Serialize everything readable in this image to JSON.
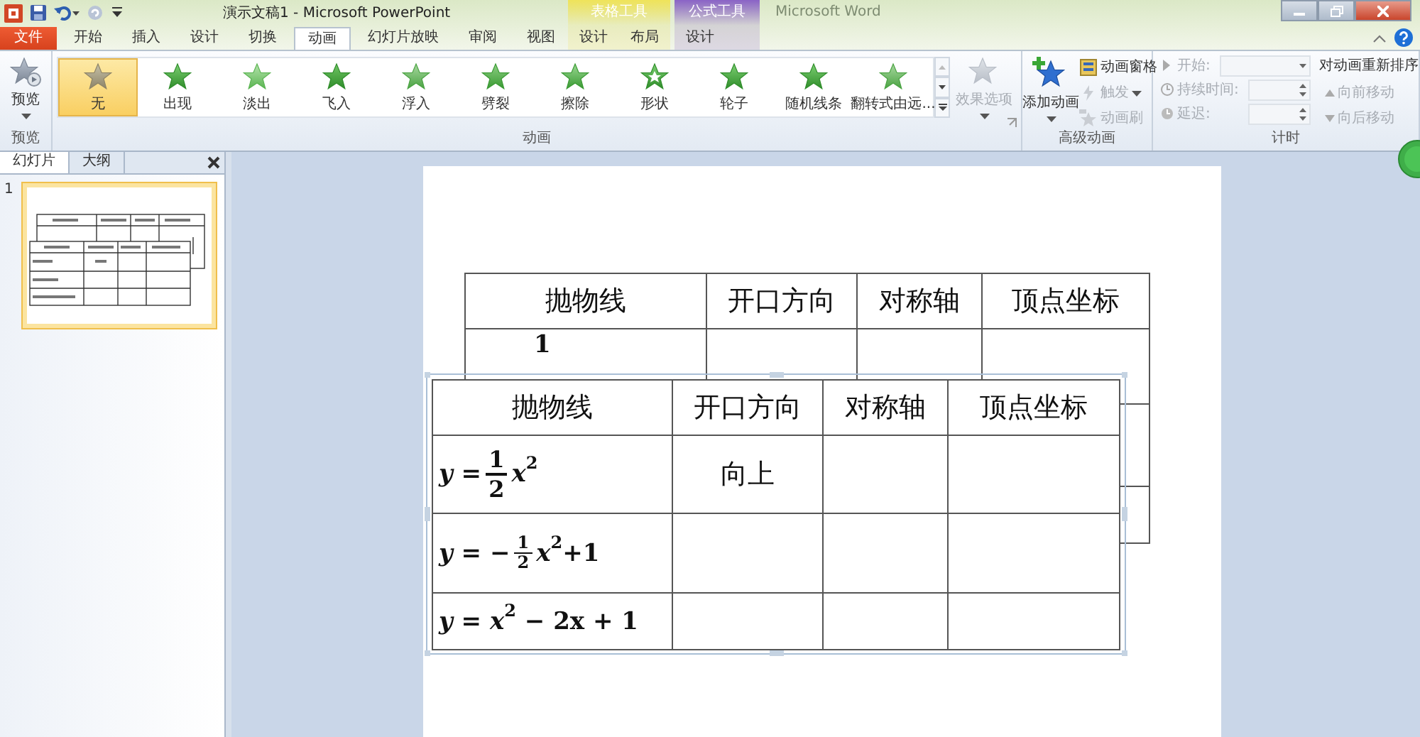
{
  "window": {
    "title": "演示文稿1 - Microsoft PowerPoint",
    "background_title": "Microsoft Word"
  },
  "tabs": [
    {
      "label": "文件",
      "kind": "file",
      "selected": false
    },
    {
      "label": "开始",
      "kind": "normal",
      "selected": false
    },
    {
      "label": "插入",
      "kind": "normal",
      "selected": false
    },
    {
      "label": "设计",
      "kind": "normal",
      "selected": false
    },
    {
      "label": "切换",
      "kind": "normal",
      "selected": false
    },
    {
      "label": "动画",
      "kind": "normal",
      "selected": true
    },
    {
      "label": "幻灯片放映",
      "kind": "normal",
      "selected": false
    },
    {
      "label": "审阅",
      "kind": "normal",
      "selected": false
    },
    {
      "label": "视图",
      "kind": "normal",
      "selected": false
    }
  ],
  "context_tabs": [
    {
      "label": "表格工具",
      "color": "#efe35a",
      "tabs": [
        {
          "label": "设计",
          "selected": false
        },
        {
          "label": "布局",
          "selected": false
        }
      ]
    },
    {
      "label": "公式工具",
      "color": "#8a63c6",
      "tabs": [
        {
          "label": "设计",
          "selected": false
        }
      ]
    }
  ],
  "ribbon": {
    "preview_group": {
      "label": "预览",
      "button": "预览"
    },
    "animation_group": {
      "label": "动画",
      "gallery": [
        {
          "label": "无",
          "selected": true
        },
        {
          "label": "出现",
          "selected": false
        },
        {
          "label": "淡出",
          "selected": false
        },
        {
          "label": "飞入",
          "selected": false
        },
        {
          "label": "浮入",
          "selected": false
        },
        {
          "label": "劈裂",
          "selected": false
        },
        {
          "label": "擦除",
          "selected": false
        },
        {
          "label": "形状",
          "selected": false
        },
        {
          "label": "轮子",
          "selected": false
        },
        {
          "label": "随机线条",
          "selected": false
        },
        {
          "label": "翻转式由远...",
          "selected": false
        }
      ],
      "effect_options": {
        "label": "效果选项",
        "disabled": true
      }
    },
    "advanced_group": {
      "label": "高级动画",
      "add_button": "添加动画",
      "items": [
        {
          "label": "动画窗格",
          "disabled": false,
          "kind": "plain"
        },
        {
          "label": "触发",
          "disabled": true,
          "kind": "dropdown"
        },
        {
          "label": "动画刷",
          "disabled": true,
          "kind": "plain"
        }
      ]
    },
    "timing_group": {
      "label": "计时",
      "fields": [
        {
          "label": "开始:",
          "kind": "dropdown",
          "disabled": true
        },
        {
          "label": "持续时间:",
          "kind": "spin",
          "disabled": true
        },
        {
          "label": "延迟:",
          "kind": "spin",
          "disabled": true
        }
      ],
      "reorder": {
        "title": "对动画重新排序",
        "items": [
          {
            "label": "向前移动",
            "kind": "up",
            "disabled": true
          },
          {
            "label": "向后移动",
            "kind": "down",
            "disabled": true
          }
        ]
      }
    }
  },
  "pane": {
    "tabs": [
      {
        "label": "幻灯片",
        "selected": true
      },
      {
        "label": "大纲",
        "selected": false
      }
    ],
    "slides": [
      {
        "number": "1",
        "selected": true
      }
    ]
  },
  "slide": {
    "back_table": {
      "columns": [
        "抛物线",
        "开口方向",
        "对称轴",
        "顶点坐标"
      ],
      "rows": [
        {
          "kind": "partly_covered",
          "fragment": "1"
        },
        {
          "kind": "covered"
        },
        {
          "kind": "covered"
        }
      ]
    },
    "front_table": {
      "columns": [
        "抛物线",
        "开口方向",
        "对称轴",
        "顶点坐标"
      ],
      "rows": [
        {
          "formula": [
            {
              "kind": "text",
              "text": "*y* = "
            },
            {
              "kind": "fraction",
              "num": "1",
              "den": "2"
            },
            {
              "kind": "text",
              "text": "*x*$^{2}$"
            }
          ],
          "opening_direction": "向上"
        },
        {
          "formula": [
            {
              "kind": "text",
              "text": "*y* = −"
            },
            {
              "kind": "small_fraction",
              "num": "1",
              "den": "2"
            },
            {
              "kind": "text",
              "text": "*x*$^{2}$+1"
            }
          ]
        },
        {
          "formula": [
            {
              "kind": "text",
              "text": "*y* = *x*$^{2}$ − 2x + 1"
            }
          ]
        }
      ]
    }
  }
}
